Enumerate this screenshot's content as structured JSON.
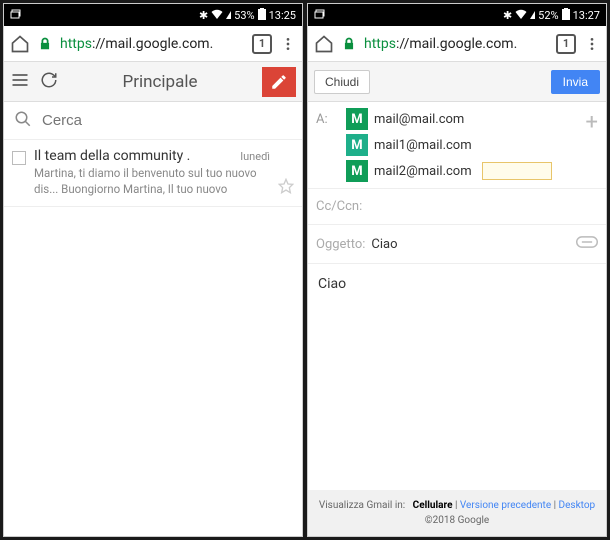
{
  "left": {
    "status": {
      "battery": "53%",
      "time": "13:25"
    },
    "browser": {
      "url_scheme": "https",
      "url_rest": "://mail.google.com.",
      "tab_count": "1"
    },
    "appbar": {
      "title": "Principale"
    },
    "search": {
      "placeholder": "Cerca"
    },
    "email": {
      "sender": "Il team della community .",
      "date": "lunedì",
      "snippet": "Martina, ti diamo il benvenuto sul tuo nuovo dis... Buongiorno Martina, Il tuo nuovo dispositivo utili..."
    }
  },
  "right": {
    "status": {
      "battery": "52%",
      "time": "13:27"
    },
    "browser": {
      "url_scheme": "https",
      "url_rest": "://mail.google.com.",
      "tab_count": "1"
    },
    "composebar": {
      "close": "Chiudi",
      "send": "Invia"
    },
    "to_label": "A:",
    "recipients": [
      {
        "initial": "M",
        "email": "mail@mail.com",
        "color": "#0f9d58"
      },
      {
        "initial": "M",
        "email": "mail1@mail.com",
        "color": "#1eaf8a"
      },
      {
        "initial": "M",
        "email": "mail2@mail.com",
        "color": "#0f9d58"
      }
    ],
    "cc_label": "Cc/Ccn:",
    "subject_label": "Oggetto:",
    "subject_value": "Ciao",
    "body": "Ciao",
    "footer": {
      "view_in": "Visualizza Gmail in:",
      "mobile": "Cellulare",
      "sep": " | ",
      "older": "Versione precedente",
      "desktop": "Desktop",
      "copyright": "©2018 Google"
    }
  }
}
